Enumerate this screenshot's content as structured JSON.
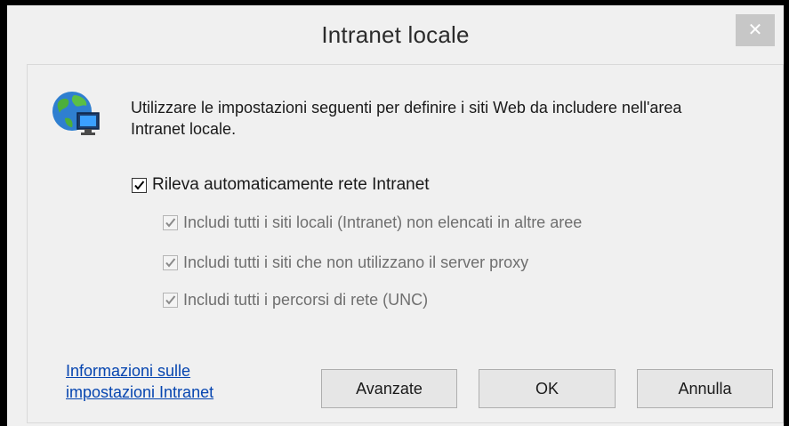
{
  "window": {
    "title": "Intranet locale",
    "close_label": "✕"
  },
  "description": "Utilizzare le impostazioni seguenti per definire i siti Web da includere nell'area Intranet locale.",
  "options": {
    "auto_detect": {
      "label": "Rileva automaticamente rete Intranet",
      "checked": true
    },
    "sub": [
      {
        "label": "Includi tutti i siti locali (Intranet) non elencati in altre aree",
        "checked": true,
        "enabled": false
      },
      {
        "label": "Includi tutti i siti che non utilizzano il server proxy",
        "checked": true,
        "enabled": false
      },
      {
        "label": "Includi tutti i percorsi di rete (UNC)",
        "checked": true,
        "enabled": false
      }
    ]
  },
  "link": {
    "line1": "Informazioni sulle",
    "line2": "impostazioni Intranet"
  },
  "buttons": {
    "advanced": "Avanzate",
    "ok": "OK",
    "cancel": "Annulla"
  },
  "icons": {
    "globe": "globe-computer-icon",
    "close": "close-icon"
  },
  "colors": {
    "link": "#0645b0",
    "close_button": "#c7c7c7",
    "disabled_text": "#6f6f6f"
  }
}
